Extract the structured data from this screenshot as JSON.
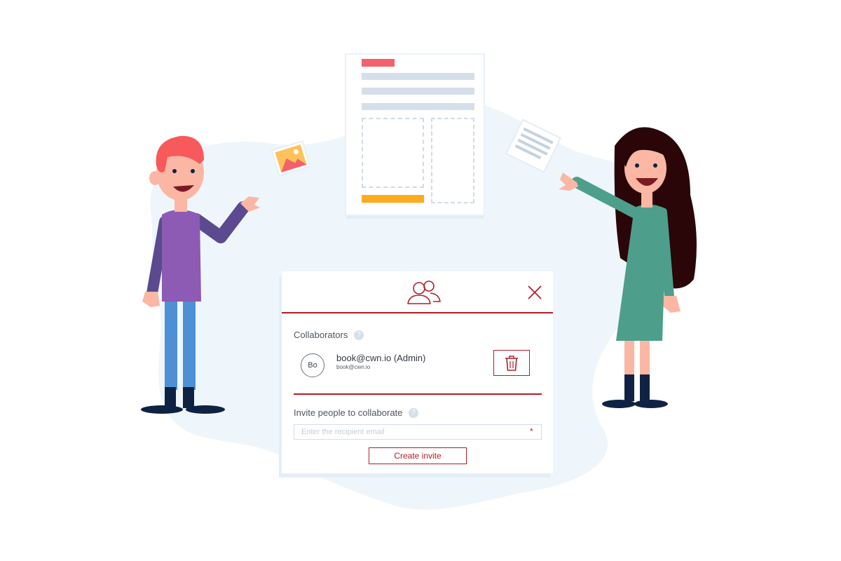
{
  "collaborators": {
    "heading": "Collaborators",
    "help_glyph": "?",
    "items": [
      {
        "initials": "Bo",
        "name": "book@cwn.io (Admin)",
        "email": "book@cwn.io"
      }
    ]
  },
  "invite": {
    "heading": "Invite people to collaborate",
    "help_glyph": "?",
    "placeholder": "Enter the recipient email",
    "required_marker": "*",
    "button_label": "Create invite"
  },
  "icons": {
    "header": "users-icon",
    "close": "close-icon",
    "delete": "trash-icon"
  },
  "colors": {
    "accent": "#b01e28",
    "doc_accent_red": "#f4606b",
    "doc_accent_orange": "#ffab1d",
    "background_blob": "#eef6fc"
  }
}
